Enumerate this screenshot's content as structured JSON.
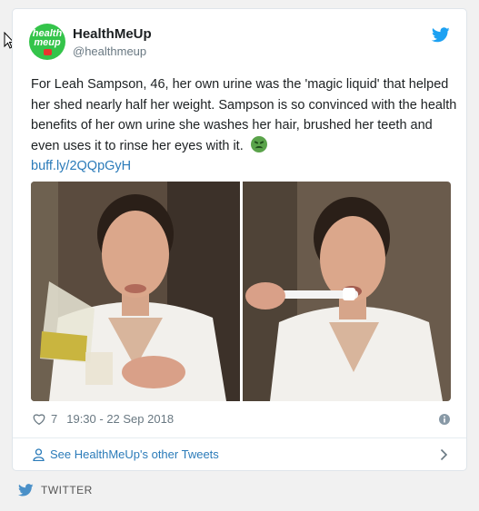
{
  "tweet": {
    "author_name": "HealthMeUp",
    "author_handle": "@healthmeup",
    "avatar_logo_top": "health",
    "avatar_logo_bottom": "meup",
    "text": "For Leah Sampson, 46, her own urine was the 'magic liquid' that helped her shed nearly half her weight. Sampson is so convinced with the health benefits of her own urine she washes her hair, brushed her teeth and even uses it to rinse her eyes with it.",
    "emoji": "nauseated-face",
    "link": "buff.ly/2QQpGyH",
    "likes": "7",
    "timestamp": "19:30 - 22 Sep 2018",
    "other_tweets_label": "See HealthMeUp's other Tweets"
  },
  "footer": {
    "label": "TWITTER"
  },
  "colors": {
    "link": "#2b7bb9",
    "twitter_blue": "#1da1f2",
    "text": "#1c2022",
    "muted": "#697882",
    "avatar_green": "#34c44a"
  }
}
